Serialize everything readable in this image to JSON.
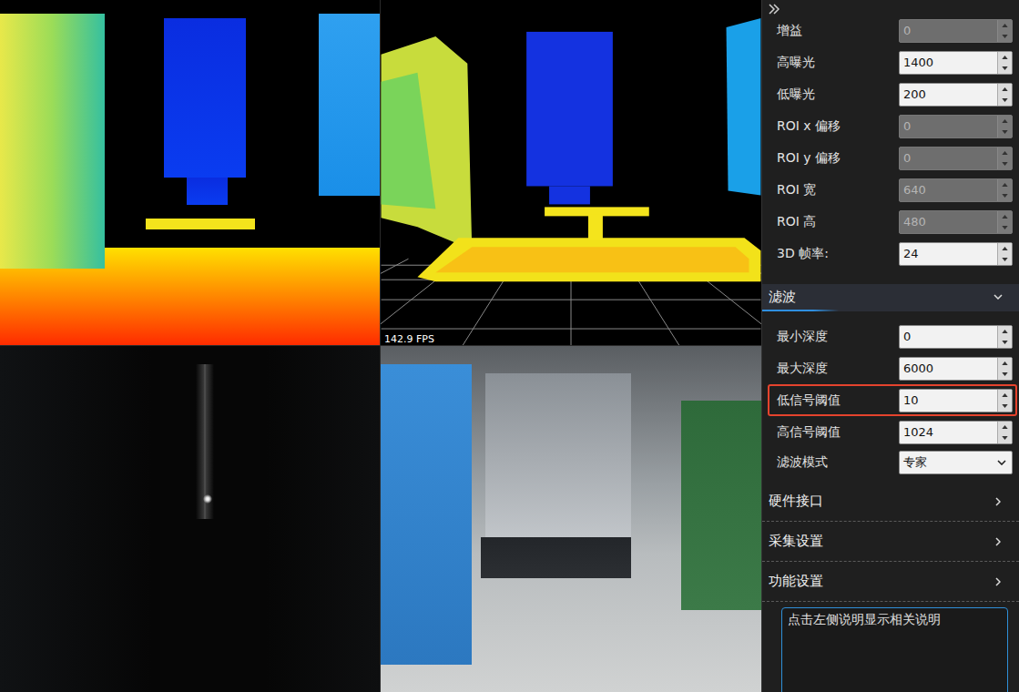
{
  "viewer": {
    "fps": "142.9 FPS"
  },
  "settings": {
    "params": [
      {
        "label": "增益",
        "value": "0",
        "kind": "spin",
        "disabled": true,
        "highlighted": false
      },
      {
        "label": "高曝光",
        "value": "1400",
        "kind": "spin",
        "disabled": false,
        "highlighted": false
      },
      {
        "label": "低曝光",
        "value": "200",
        "kind": "spin",
        "disabled": false,
        "highlighted": false
      },
      {
        "label": "ROI x 偏移",
        "value": "0",
        "kind": "spin",
        "disabled": true,
        "highlighted": false
      },
      {
        "label": "ROI y 偏移",
        "value": "0",
        "kind": "spin",
        "disabled": true,
        "highlighted": false
      },
      {
        "label": "ROI 宽",
        "value": "640",
        "kind": "spin",
        "disabled": true,
        "highlighted": false
      },
      {
        "label": "ROI 高",
        "value": "480",
        "kind": "spin",
        "disabled": true,
        "highlighted": false
      },
      {
        "label": "3D 帧率:",
        "value": "24",
        "kind": "spin",
        "disabled": false,
        "highlighted": false
      }
    ],
    "filter_section": {
      "title": "滤波",
      "expanded": true,
      "rows": [
        {
          "label": "最小深度",
          "value": "0",
          "kind": "spin",
          "disabled": false,
          "highlighted": false
        },
        {
          "label": "最大深度",
          "value": "6000",
          "kind": "spin",
          "disabled": false,
          "highlighted": false
        },
        {
          "label": "低信号阈值",
          "value": "10",
          "kind": "spin",
          "disabled": false,
          "highlighted": true
        },
        {
          "label": "高信号阈值",
          "value": "1024",
          "kind": "spin",
          "disabled": false,
          "highlighted": false
        },
        {
          "label": "滤波模式",
          "value": "专家",
          "kind": "select",
          "disabled": false,
          "highlighted": false
        }
      ]
    },
    "sections": [
      {
        "title": "硬件接口",
        "expanded": false
      },
      {
        "title": "采集设置",
        "expanded": false
      },
      {
        "title": "功能设置",
        "expanded": false
      }
    ],
    "description": {
      "text": "点击左侧说明显示相关说明"
    }
  }
}
